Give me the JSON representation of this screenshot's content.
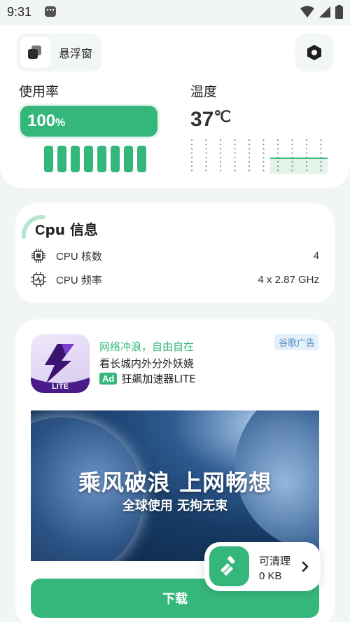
{
  "status_bar": {
    "time": "9:31"
  },
  "header": {
    "float_window_label": "悬浮窗"
  },
  "usage": {
    "title": "使用率",
    "value": "100",
    "unit": "%",
    "fraction": 1.0,
    "core_count": 8
  },
  "temperature": {
    "title": "温度",
    "value": "37",
    "unit": "℃"
  },
  "cpu_info": {
    "title_prefix": "C",
    "title_rest": "pu 信息",
    "rows": [
      {
        "label": "CPU 核数",
        "value": "4"
      },
      {
        "label": "CPU 频率",
        "value": "4 x 2.87 GHz"
      }
    ]
  },
  "ad": {
    "badge": "谷歌广告",
    "line1": "网络冲浪，自由自在",
    "line2": "看长城内外分外妖娆",
    "tag": "Ad",
    "app_name": "狂飙加速器LITE",
    "icon_text": "LITE",
    "banner_title": "乘风破浪 上网畅想",
    "banner_subtitle": "全球使用 无拘无束",
    "download_label": "下载"
  },
  "cleaner": {
    "label": "可清理",
    "size": "0 KB"
  },
  "colors": {
    "accent": "#35b77c",
    "accent_light": "#e2f3ea",
    "background": "#f1f5f3"
  }
}
